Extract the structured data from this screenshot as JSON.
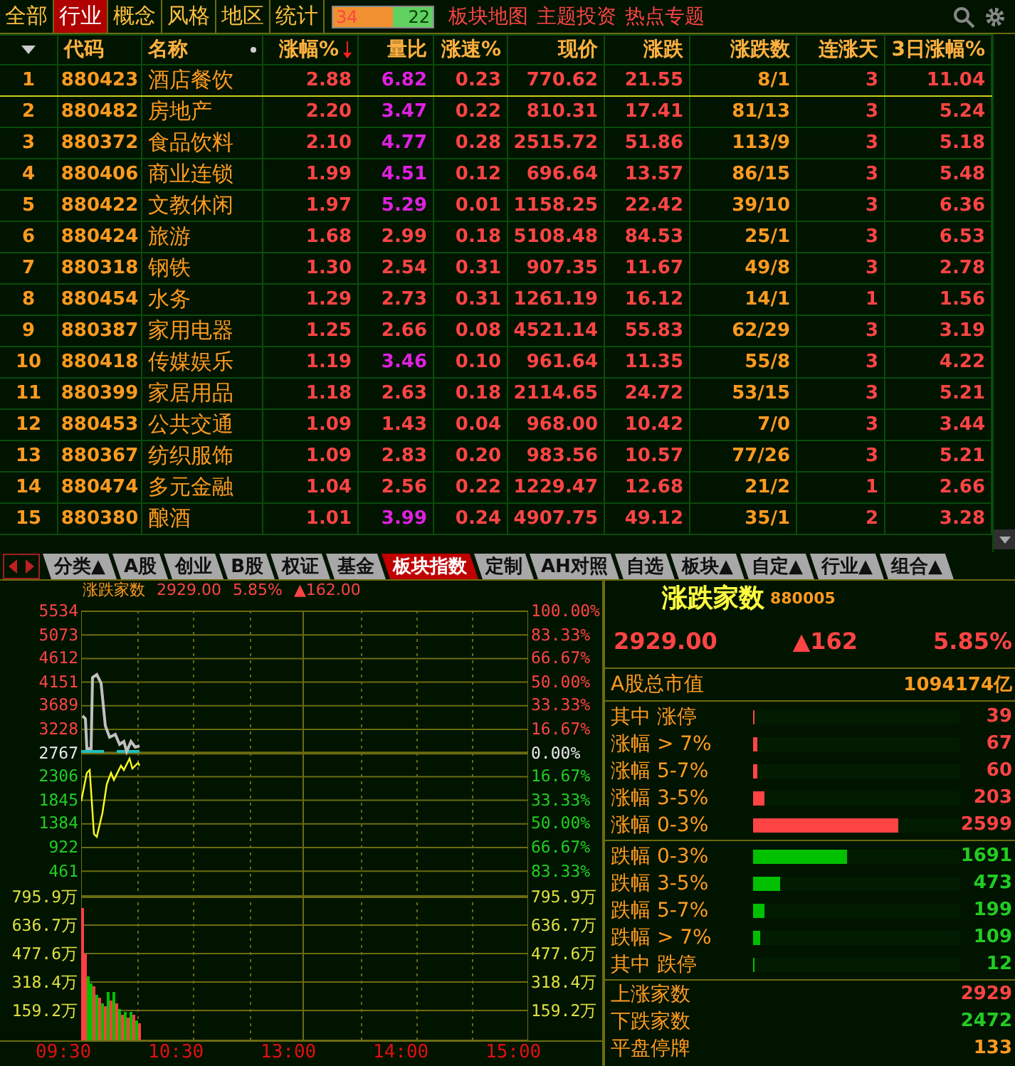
{
  "top_tabs": [
    {
      "label": "全部",
      "selected": false
    },
    {
      "label": "行业",
      "selected": true
    },
    {
      "label": "概念",
      "selected": false
    },
    {
      "label": "风格",
      "selected": false
    },
    {
      "label": "地区",
      "selected": false
    },
    {
      "label": "统计",
      "selected": false
    }
  ],
  "ratio_bar": {
    "up": "34",
    "down": "22",
    "level": 0.6
  },
  "top_links": [
    "板块地图",
    "主题投资",
    "热点专题"
  ],
  "table": {
    "columns": [
      "代码",
      "名称",
      "涨幅%",
      "量比",
      "涨速%",
      "现价",
      "涨跌",
      "涨跌数",
      "连涨天",
      "3日涨幅%"
    ],
    "rows": [
      {
        "num": "1",
        "code": "880423",
        "name": "酒店餐饮",
        "pct": "2.88",
        "ratio": "6.82",
        "ratio_hot": true,
        "speed": "0.23",
        "price": "770.62",
        "change": "21.55",
        "count": "8/1",
        "streak": "3",
        "three_day": "11.04",
        "selected": true
      },
      {
        "num": "2",
        "code": "880482",
        "name": "房地产",
        "pct": "2.20",
        "ratio": "3.47",
        "ratio_hot": true,
        "speed": "0.22",
        "price": "810.31",
        "change": "17.41",
        "count": "81/13",
        "streak": "3",
        "three_day": "5.24",
        "selected": false
      },
      {
        "num": "3",
        "code": "880372",
        "name": "食品饮料",
        "pct": "2.10",
        "ratio": "4.77",
        "ratio_hot": true,
        "speed": "0.28",
        "price": "2515.72",
        "change": "51.86",
        "count": "113/9",
        "streak": "3",
        "three_day": "5.18",
        "selected": false
      },
      {
        "num": "4",
        "code": "880406",
        "name": "商业连锁",
        "pct": "1.99",
        "ratio": "4.51",
        "ratio_hot": true,
        "speed": "0.12",
        "price": "696.64",
        "change": "13.57",
        "count": "86/15",
        "streak": "3",
        "three_day": "5.48",
        "selected": false
      },
      {
        "num": "5",
        "code": "880422",
        "name": "文教休闲",
        "pct": "1.97",
        "ratio": "5.29",
        "ratio_hot": true,
        "speed": "0.01",
        "price": "1158.25",
        "change": "22.42",
        "count": "39/10",
        "streak": "3",
        "three_day": "6.36",
        "selected": false
      },
      {
        "num": "6",
        "code": "880424",
        "name": "旅游",
        "pct": "1.68",
        "ratio": "2.99",
        "ratio_hot": false,
        "speed": "0.18",
        "price": "5108.48",
        "change": "84.53",
        "count": "25/1",
        "streak": "3",
        "three_day": "6.53",
        "selected": false
      },
      {
        "num": "7",
        "code": "880318",
        "name": "钢铁",
        "pct": "1.30",
        "ratio": "2.54",
        "ratio_hot": false,
        "speed": "0.31",
        "price": "907.35",
        "change": "11.67",
        "count": "49/8",
        "streak": "3",
        "three_day": "2.78",
        "selected": false
      },
      {
        "num": "8",
        "code": "880454",
        "name": "水务",
        "pct": "1.29",
        "ratio": "2.73",
        "ratio_hot": false,
        "speed": "0.31",
        "price": "1261.19",
        "change": "16.12",
        "count": "14/1",
        "streak": "1",
        "three_day": "1.56",
        "selected": false
      },
      {
        "num": "9",
        "code": "880387",
        "name": "家用电器",
        "pct": "1.25",
        "ratio": "2.66",
        "ratio_hot": false,
        "speed": "0.08",
        "price": "4521.14",
        "change": "55.83",
        "count": "62/29",
        "streak": "3",
        "three_day": "3.19",
        "selected": false
      },
      {
        "num": "10",
        "code": "880418",
        "name": "传媒娱乐",
        "pct": "1.19",
        "ratio": "3.46",
        "ratio_hot": true,
        "speed": "0.10",
        "price": "961.64",
        "change": "11.35",
        "count": "55/8",
        "streak": "3",
        "three_day": "4.22",
        "selected": false
      },
      {
        "num": "11",
        "code": "880399",
        "name": "家居用品",
        "pct": "1.18",
        "ratio": "2.63",
        "ratio_hot": false,
        "speed": "0.18",
        "price": "2114.65",
        "change": "24.72",
        "count": "53/15",
        "streak": "3",
        "three_day": "5.21",
        "selected": false
      },
      {
        "num": "12",
        "code": "880453",
        "name": "公共交通",
        "pct": "1.09",
        "ratio": "1.43",
        "ratio_hot": false,
        "speed": "0.04",
        "price": "968.00",
        "change": "10.42",
        "count": "7/0",
        "streak": "3",
        "three_day": "3.44",
        "selected": false
      },
      {
        "num": "13",
        "code": "880367",
        "name": "纺织服饰",
        "pct": "1.09",
        "ratio": "2.83",
        "ratio_hot": false,
        "speed": "0.20",
        "price": "983.56",
        "change": "10.57",
        "count": "77/26",
        "streak": "3",
        "three_day": "5.21",
        "selected": false
      },
      {
        "num": "14",
        "code": "880474",
        "name": "多元金融",
        "pct": "1.04",
        "ratio": "2.56",
        "ratio_hot": false,
        "speed": "0.22",
        "price": "1229.47",
        "change": "12.68",
        "count": "21/2",
        "streak": "1",
        "three_day": "2.66",
        "selected": false
      },
      {
        "num": "15",
        "code": "880380",
        "name": "酿酒",
        "pct": "1.01",
        "ratio": "3.99",
        "ratio_hot": true,
        "speed": "0.24",
        "price": "4907.75",
        "change": "49.12",
        "count": "35/1",
        "streak": "2",
        "three_day": "3.28",
        "selected": false
      }
    ]
  },
  "bottom_tabs": [
    {
      "label": "分类▲",
      "selected": false
    },
    {
      "label": "A股",
      "selected": false
    },
    {
      "label": "创业",
      "selected": false
    },
    {
      "label": "B股",
      "selected": false
    },
    {
      "label": "权证",
      "selected": false
    },
    {
      "label": "基金",
      "selected": false
    },
    {
      "label": "板块指数",
      "selected": true
    },
    {
      "label": "定制",
      "selected": false
    },
    {
      "label": "AH对照",
      "selected": false
    },
    {
      "label": "自选",
      "selected": false
    },
    {
      "label": "板块▲",
      "selected": false
    },
    {
      "label": "自定▲",
      "selected": false
    },
    {
      "label": "行业▲",
      "selected": false
    },
    {
      "label": "组合▲",
      "selected": false
    }
  ],
  "chart": {
    "name": "涨跌家数",
    "price": "2929.00",
    "pct": "5.85%",
    "change": "▲162.00",
    "left_axis": [
      {
        "text": "5534",
        "kind": "up"
      },
      {
        "text": "5073",
        "kind": "up"
      },
      {
        "text": "4612",
        "kind": "up"
      },
      {
        "text": "4151",
        "kind": "up"
      },
      {
        "text": "3689",
        "kind": "up"
      },
      {
        "text": "3228",
        "kind": "up"
      },
      {
        "text": "2767",
        "kind": "flat"
      },
      {
        "text": "2306",
        "kind": "down"
      },
      {
        "text": "1845",
        "kind": "down"
      },
      {
        "text": "1384",
        "kind": "down"
      },
      {
        "text": "922",
        "kind": "down"
      },
      {
        "text": "461",
        "kind": "down"
      }
    ],
    "right_axis": [
      {
        "text": "100.00%",
        "kind": "up"
      },
      {
        "text": "83.33%",
        "kind": "up"
      },
      {
        "text": "66.67%",
        "kind": "up"
      },
      {
        "text": "50.00%",
        "kind": "up"
      },
      {
        "text": "33.33%",
        "kind": "up"
      },
      {
        "text": "16.67%",
        "kind": "up"
      },
      {
        "text": "0.00%",
        "kind": "flat"
      },
      {
        "text": "16.67%",
        "kind": "down"
      },
      {
        "text": "33.33%",
        "kind": "down"
      },
      {
        "text": "50.00%",
        "kind": "down"
      },
      {
        "text": "66.67%",
        "kind": "down"
      },
      {
        "text": "83.33%",
        "kind": "down"
      }
    ],
    "volume_axis": [
      "795.9万",
      "636.7万",
      "477.6万",
      "318.4万",
      "159.2万"
    ],
    "volume_axis_right": [
      "795.9万",
      "636.7万",
      "477.6万",
      "318.4万",
      "159.2万"
    ],
    "time_axis": [
      "09:30",
      "10:30",
      "13:00",
      "14:00",
      "15:00"
    ]
  },
  "summary": {
    "title": "涨跌家数",
    "code": "880005",
    "price": "2929.00",
    "change": "▲162",
    "pct": "5.85%",
    "cap_label": "A股总市值",
    "cap_value": "1094174亿",
    "breakdown": [
      {
        "label": "其中 涨停",
        "value": "39",
        "kind": "up",
        "level": 0.007
      },
      {
        "label": "涨幅 > 7%",
        "value": "67",
        "kind": "up",
        "level": 0.02
      },
      {
        "label": "涨幅 5-7%",
        "value": "60",
        "kind": "up",
        "level": 0.02
      },
      {
        "label": "涨幅 3-5%",
        "value": "203",
        "kind": "up",
        "level": 0.055
      },
      {
        "label": "涨幅 0-3%",
        "value": "2599",
        "kind": "up",
        "level": 0.7
      },
      {
        "label": "跌幅 0-3%",
        "value": "1691",
        "kind": "down",
        "level": 0.455
      },
      {
        "label": "跌幅 3-5%",
        "value": "473",
        "kind": "down",
        "level": 0.13
      },
      {
        "label": "跌幅 5-7%",
        "value": "199",
        "kind": "down",
        "level": 0.055
      },
      {
        "label": "跌幅 > 7%",
        "value": "109",
        "kind": "down",
        "level": 0.035
      },
      {
        "label": "其中 跌停",
        "value": "12",
        "kind": "down",
        "level": 0.007
      }
    ],
    "totals": [
      {
        "label": "上涨家数",
        "value": "2929",
        "kind": "up"
      },
      {
        "label": "下跌家数",
        "value": "2472",
        "kind": "down"
      },
      {
        "label": "平盘停牌",
        "value": "133",
        "kind": "flat"
      }
    ]
  }
}
